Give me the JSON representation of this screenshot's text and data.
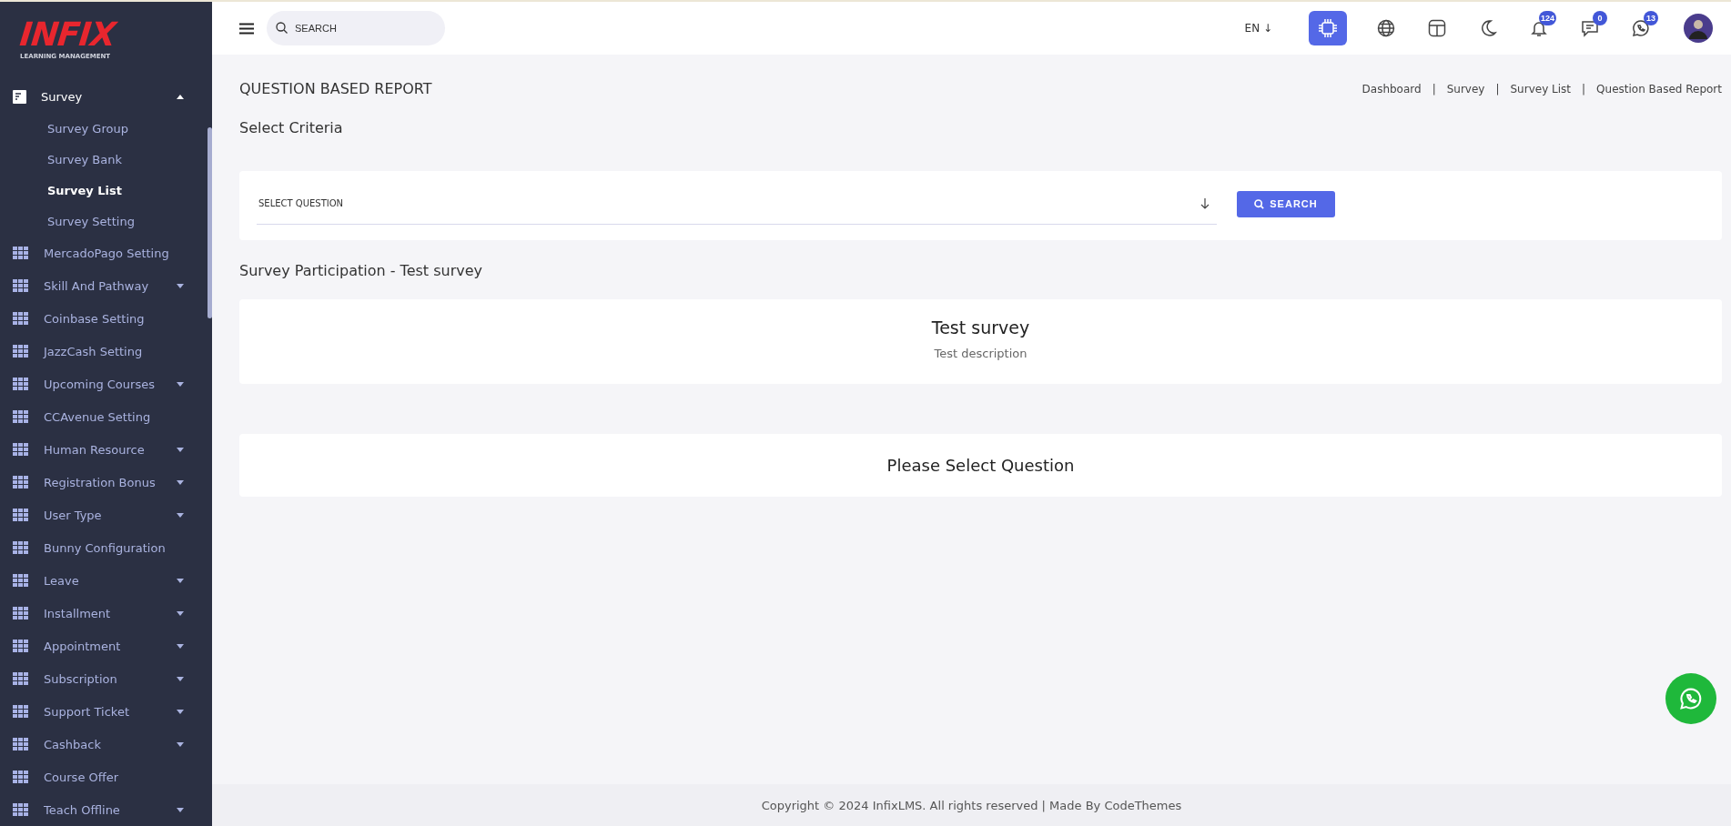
{
  "logo": {
    "brand": "INFIX",
    "tagline": "LEARNING MANAGEMENT"
  },
  "sidebar": {
    "items": [
      {
        "label": "Survey",
        "kind": "document",
        "expandable": true,
        "expanded": true,
        "children": [
          {
            "label": "Survey Group",
            "selected": false
          },
          {
            "label": "Survey Bank",
            "selected": false
          },
          {
            "label": "Survey List",
            "selected": true
          },
          {
            "label": "Survey Setting",
            "selected": false
          }
        ]
      },
      {
        "label": "MercadoPago Setting",
        "kind": "grid",
        "expandable": false,
        "expanded": false
      },
      {
        "label": "Skill And Pathway",
        "kind": "grid",
        "expandable": true,
        "expanded": false
      },
      {
        "label": "Coinbase Setting",
        "kind": "grid",
        "expandable": false,
        "expanded": false
      },
      {
        "label": "JazzCash Setting",
        "kind": "grid",
        "expandable": false,
        "expanded": false
      },
      {
        "label": "Upcoming Courses",
        "kind": "grid",
        "expandable": true,
        "expanded": false
      },
      {
        "label": "CCAvenue Setting",
        "kind": "grid",
        "expandable": false,
        "expanded": false
      },
      {
        "label": "Human Resource",
        "kind": "grid",
        "expandable": true,
        "expanded": false
      },
      {
        "label": "Registration Bonus",
        "kind": "grid",
        "expandable": true,
        "expanded": false
      },
      {
        "label": "User Type",
        "kind": "grid",
        "expandable": true,
        "expanded": false
      },
      {
        "label": "Bunny Configuration",
        "kind": "grid",
        "expandable": false,
        "expanded": false
      },
      {
        "label": "Leave",
        "kind": "grid",
        "expandable": true,
        "expanded": false
      },
      {
        "label": "Installment",
        "kind": "grid",
        "expandable": true,
        "expanded": false
      },
      {
        "label": "Appointment",
        "kind": "grid",
        "expandable": true,
        "expanded": false
      },
      {
        "label": "Subscription",
        "kind": "grid",
        "expandable": true,
        "expanded": false
      },
      {
        "label": "Support Ticket",
        "kind": "grid",
        "expandable": true,
        "expanded": false
      },
      {
        "label": "Cashback",
        "kind": "grid",
        "expandable": true,
        "expanded": false
      },
      {
        "label": "Course Offer",
        "kind": "grid",
        "expandable": false,
        "expanded": false
      },
      {
        "label": "Teach Offline",
        "kind": "grid",
        "expandable": true,
        "expanded": false
      }
    ]
  },
  "topbar": {
    "search": {
      "placeholder": "SEARCH"
    },
    "language": "EN ↓",
    "icons": [
      {
        "kind": "ai",
        "selected": true
      },
      {
        "kind": "globe",
        "selected": false
      },
      {
        "kind": "layout",
        "selected": false
      },
      {
        "kind": "moon",
        "selected": false
      },
      {
        "kind": "bell",
        "selected": false,
        "badge": "124"
      },
      {
        "kind": "chat",
        "selected": false,
        "badge": "0"
      },
      {
        "kind": "whatsapp",
        "selected": false,
        "badge": "13"
      }
    ]
  },
  "page": {
    "title": "QUESTION BASED REPORT",
    "breadcrumbs": {
      "links": [
        "Dashboard",
        "Survey",
        "Survey List",
        "Question Based Report"
      ],
      "separators": [
        "|",
        "|",
        "|"
      ]
    },
    "criteria_title": "Select Criteria",
    "select": {
      "placeholder": "SELECT QUESTION"
    },
    "search_button": "SEARCH",
    "participation_title": "Survey Participation - Test survey",
    "survey": {
      "title": "Test survey",
      "description": "Test description"
    },
    "message": "Please Select Question"
  },
  "footer": "Copyright © 2024 InfixLMS. All rights reserved | Made By CodeThemes"
}
